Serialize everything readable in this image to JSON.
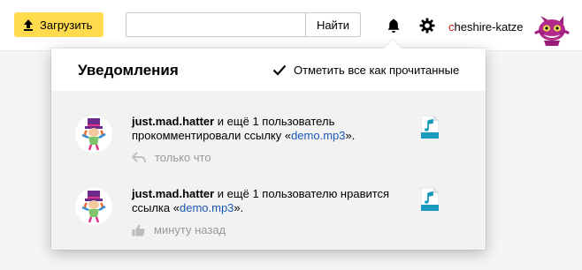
{
  "header": {
    "upload_label": "Загрузить",
    "search_value": "",
    "search_button_label": "Найти",
    "username_first": "c",
    "username_rest": "heshire-katze"
  },
  "notifications": {
    "title": "Уведомления",
    "mark_all_read_label": "Отметить все как прочитанные",
    "items": [
      {
        "user": "just.mad.hatter",
        "text_before": " и ещё 1 пользователь прокомментировали ссылку «",
        "link": "demo.mp3",
        "text_after": "».",
        "action_icon": "reply-icon",
        "time": "только что",
        "file_icon": "audio-file-icon"
      },
      {
        "user": "just.mad.hatter",
        "text_before": " и ещё 1 пользователю нравится ссылка «",
        "link": "demo.mp3",
        "text_after": "».",
        "action_icon": "thumbs-up-icon",
        "time": "минуту назад",
        "file_icon": "audio-file-icon"
      }
    ]
  },
  "colors": {
    "upload_button": "#ffdb4d",
    "link": "#1a57b6",
    "username_first_letter": "#e61400",
    "file_icon": "#1a9bbd"
  }
}
